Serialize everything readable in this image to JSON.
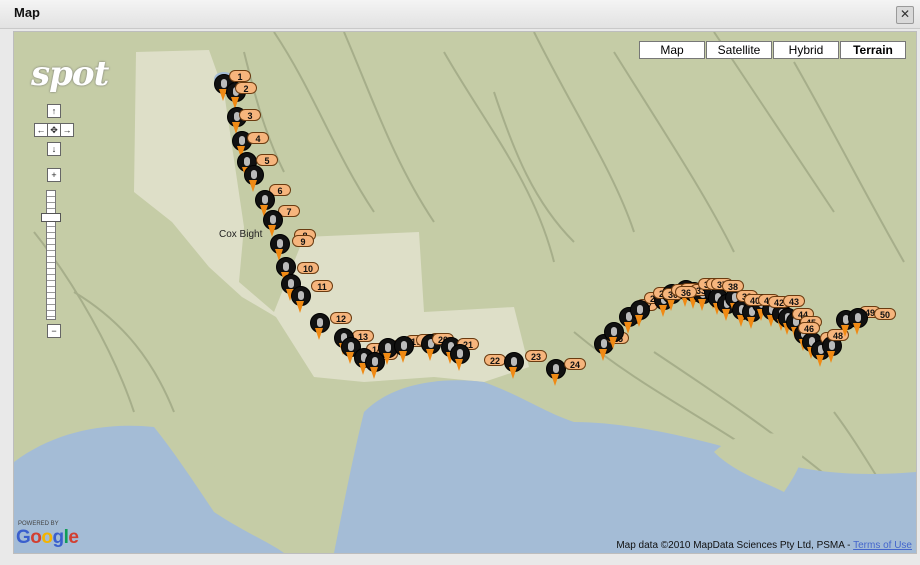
{
  "window": {
    "title": "Map",
    "close_icon": "close-icon"
  },
  "map_type": {
    "buttons": [
      "Map",
      "Satellite",
      "Hybrid",
      "Terrain"
    ],
    "selected": "Terrain"
  },
  "logo": {
    "text": "spot"
  },
  "nav": {
    "up": "↑",
    "left": "←",
    "center": "✥",
    "right": "→",
    "down": "↓",
    "zoom_in": "+",
    "zoom_out": "−"
  },
  "place_label": "Cox Bight",
  "markers": [
    {
      "label": "1"
    },
    {
      "label": "2"
    },
    {
      "label": "3"
    },
    {
      "label": "4"
    },
    {
      "label": "5"
    },
    {
      "label": "6"
    },
    {
      "label": "7"
    },
    {
      "label": "8"
    },
    {
      "label": "9"
    },
    {
      "label": "10"
    },
    {
      "label": "11"
    },
    {
      "label": "12"
    },
    {
      "label": "13"
    },
    {
      "label": "14"
    },
    {
      "label": "15"
    },
    {
      "label": "16"
    },
    {
      "label": "17"
    },
    {
      "label": "18"
    },
    {
      "label": "19"
    },
    {
      "label": "20"
    },
    {
      "label": "21"
    },
    {
      "label": "22"
    },
    {
      "label": "23"
    },
    {
      "label": "24"
    },
    {
      "label": "25"
    },
    {
      "label": "26"
    },
    {
      "label": "27"
    },
    {
      "label": "28"
    },
    {
      "label": "29"
    },
    {
      "label": "30"
    },
    {
      "label": "31"
    },
    {
      "label": "32"
    },
    {
      "label": "33"
    },
    {
      "label": "34"
    },
    {
      "label": "35"
    },
    {
      "label": "36"
    },
    {
      "label": "37"
    },
    {
      "label": "38"
    },
    {
      "label": "39"
    },
    {
      "label": "40"
    },
    {
      "label": "41"
    },
    {
      "label": "42"
    },
    {
      "label": "43"
    },
    {
      "label": "44"
    },
    {
      "label": "45"
    },
    {
      "label": "46"
    },
    {
      "label": "47"
    },
    {
      "label": "48"
    },
    {
      "label": "49"
    },
    {
      "label": "50"
    }
  ],
  "google": {
    "powered_by": "POWERED BY",
    "logo": "Google"
  },
  "attribution": {
    "text": "Map data ©2010 MapData Sciences Pty Ltd, PSMA -",
    "link": "Terms of Use"
  },
  "colors": {
    "water": "#a4bcd6",
    "land": "#c7ceaa",
    "marker_label": "#f6b57d",
    "marker_tail": "#f08a14"
  }
}
